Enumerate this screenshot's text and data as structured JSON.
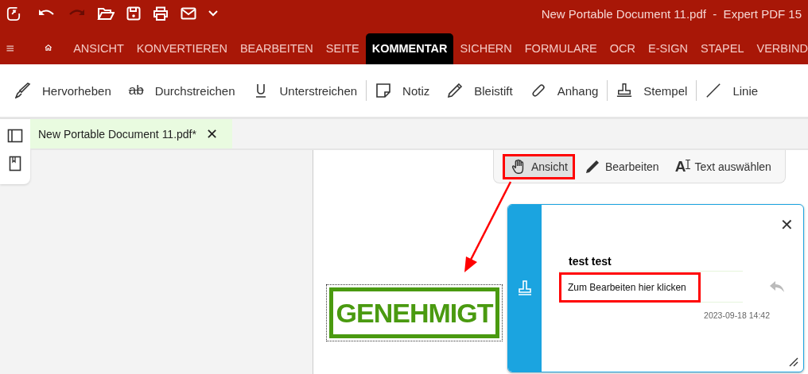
{
  "window": {
    "title": "New Portable Document 11.pdf  -  Expert PDF 15"
  },
  "tabs": [
    {
      "label": "ANSICHT",
      "selected": false
    },
    {
      "label": "KONVERTIEREN",
      "selected": false
    },
    {
      "label": "BEARBEITEN",
      "selected": false
    },
    {
      "label": "SEITE",
      "selected": false
    },
    {
      "label": "KOMMENTAR",
      "selected": true
    },
    {
      "label": "SICHERN",
      "selected": false
    },
    {
      "label": "FORMULARE",
      "selected": false
    },
    {
      "label": "OCR",
      "selected": false
    },
    {
      "label": "E-SIGN",
      "selected": false
    },
    {
      "label": "STAPEL",
      "selected": false
    },
    {
      "label": "VERBIND",
      "selected": false
    }
  ],
  "toolbar": {
    "groups": [
      {
        "tools": [
          {
            "label": "Hervorheben"
          },
          {
            "label": "Durchstreichen",
            "icon_text": "ab"
          },
          {
            "label": "Unterstreichen"
          }
        ]
      },
      {
        "tools": [
          {
            "label": "Notiz"
          },
          {
            "label": "Bleistift"
          },
          {
            "label": "Anhang"
          }
        ]
      },
      {
        "tools": [
          {
            "label": "Stempel"
          }
        ]
      },
      {
        "tools": [
          {
            "label": "Linie"
          }
        ]
      }
    ]
  },
  "document_tab": {
    "label": "New Portable Document 11.pdf*",
    "close": "✕"
  },
  "mode_toolbar": [
    {
      "label": "Ansicht",
      "selected": true,
      "highlighted": true
    },
    {
      "label": "Bearbeiten",
      "selected": false,
      "highlighted": false
    },
    {
      "label": "Text auswählen",
      "icon_text": "A",
      "selected": false,
      "highlighted": false
    }
  ],
  "stamp": {
    "text": "GENEHMIGT"
  },
  "comment": {
    "close": "✕",
    "author": "test test",
    "placeholder": "Zum Bearbeiten hier klicken",
    "highlighted": true,
    "timestamp": "2023-09-18 14:42"
  }
}
